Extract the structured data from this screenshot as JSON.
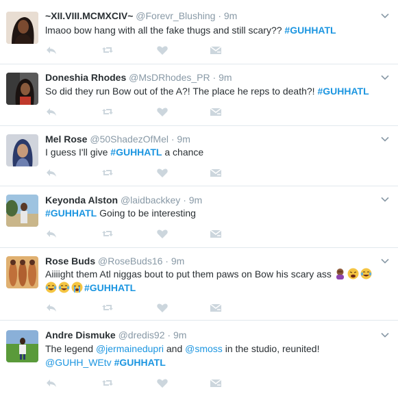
{
  "tweets": [
    {
      "name": "~XII.VIII.MCMXCIV~",
      "handle": "@Forevr_Blushing",
      "dot": "·",
      "time": "9m",
      "text_plain": "lmaoo bow hang with all the fake thugs and still scary?? ",
      "hashtag": "#GUHHATL",
      "avatar": "avatar-woman-dark-hair"
    },
    {
      "name": "Doneshia Rhodes",
      "handle": "@MsDRhodes_PR",
      "dot": "·",
      "time": "9m",
      "text_plain": "So did they run Bow out of the A?! The place he reps to death?! ",
      "hashtag": "#GUHHATL",
      "avatar": "avatar-woman-car"
    },
    {
      "name": "Mel Rose",
      "handle": "@50ShadezOfMel",
      "dot": "·",
      "time": "9m",
      "text_plain": "I guess I'll give ",
      "hashtag": "#GUHHATL",
      "text_after": " a chance",
      "avatar": "avatar-woman-blue-hair"
    },
    {
      "name": "Keyonda Alston",
      "handle": "@laidbackkey",
      "dot": "·",
      "time": "9m",
      "hashtag": "#GUHHATL",
      "text_after": " Going to be interesting",
      "avatar": "avatar-person-beach"
    },
    {
      "name": "Rose Buds",
      "handle": "@RoseBuds16",
      "dot": "·",
      "time": "9m",
      "text_plain": "Aiiiight them Atl niggas bout to put them paws on Bow  his scary ass ",
      "hashtag": "#GUHHATL",
      "emojis_line1": [
        "woman-facepalm-emoji",
        "weary-face-emoji",
        "joy-emoji"
      ],
      "emojis_line2": [
        "joy-emoji",
        "joy-emoji",
        "sob-emoji"
      ],
      "avatar": "avatar-group-photo"
    },
    {
      "name": "Andre Dismuke",
      "handle": "@dredis92",
      "dot": "·",
      "time": "9m",
      "text_plain": "The legend ",
      "mention1": "@jermainedupri",
      "text_mid1": " and ",
      "mention2": "@smoss",
      "text_mid2": " in the studio, reunited!",
      "mention3": "@GUHH_WEtv",
      "hashtag": "#GUHHATL",
      "avatar": "avatar-man-grass"
    }
  ],
  "colors": {
    "hashtag": "#1b95e0",
    "action_icon": "#ccd6dd",
    "muted_text": "#8899a6",
    "divider": "#e1e8ed"
  },
  "icons": {
    "reply": "reply-icon",
    "retweet": "retweet-icon",
    "like": "heart-icon",
    "message": "direct-message-icon",
    "more": "chevron-down-icon"
  }
}
